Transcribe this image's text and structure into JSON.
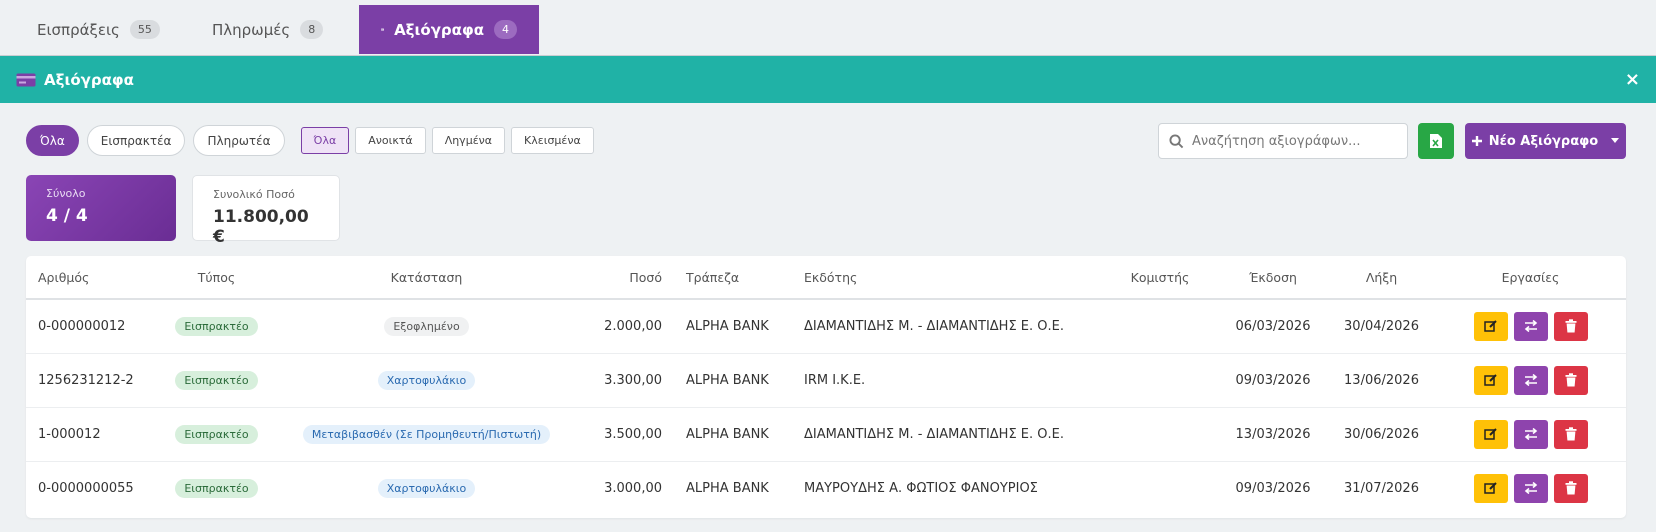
{
  "tabs": [
    {
      "label": "Εισπράξεις",
      "count": "55",
      "icon": "arrow-down-icon"
    },
    {
      "label": "Πληρωμές",
      "count": "8",
      "icon": "arrow-up-icon"
    },
    {
      "label": "Αξιόγραφα",
      "count": "4",
      "icon": "cheque-icon"
    }
  ],
  "panel": {
    "title": "Αξιόγραφα",
    "close": "×"
  },
  "type_filters": [
    "Όλα",
    "Εισπρακτέα",
    "Πληρωτέα"
  ],
  "status_filters": [
    "Όλα",
    "Ανοικτά",
    "Ληγμένα",
    "Κλεισμένα"
  ],
  "search": {
    "placeholder": "Αναζήτηση αξιογράφων..."
  },
  "new_button": {
    "label": "Νέο Αξιόγραφο"
  },
  "cards": {
    "total": {
      "label": "Σύνολο",
      "value": "4 / 4"
    },
    "amount": {
      "label": "Συνολικό Ποσό",
      "value": "11.800,00 €"
    }
  },
  "columns": [
    "Αριθμός",
    "Τύπος",
    "Κατάσταση",
    "Ποσό",
    "Τράπεζα",
    "Εκδότης",
    "Κομιστής",
    "Έκδοση",
    "Λήξη",
    "Εργασίες"
  ],
  "rows": [
    {
      "number": "0-000000012",
      "type": "Εισπρακτέο",
      "status": "Εξοφλημένο",
      "status_color": "grey",
      "amount": "2.000,00",
      "bank": "ALPHA BANK",
      "issuer": "ΔΙΑΜΑΝΤΙΔΗΣ Μ. - ΔΙΑΜΑΝΤΙΔΗΣ Ε. Ο.Ε.",
      "bearer": "",
      "issued": "06/03/2026",
      "due": "30/04/2026"
    },
    {
      "number": "1256231212-2",
      "type": "Εισπρακτέο",
      "status": "Χαρτοφυλάκιο",
      "status_color": "blue",
      "amount": "3.300,00",
      "bank": "ALPHA BANK",
      "issuer": "IRM I.K.E.",
      "bearer": "",
      "issued": "09/03/2026",
      "due": "13/06/2026"
    },
    {
      "number": "1-000012",
      "type": "Εισπρακτέο",
      "status": "Μεταβιβασθέν (Σε Προμηθευτή/Πιστωτή)",
      "status_color": "blue",
      "amount": "3.500,00",
      "bank": "ALPHA BANK",
      "issuer": "ΔΙΑΜΑΝΤΙΔΗΣ Μ. - ΔΙΑΜΑΝΤΙΔΗΣ Ε. Ο.Ε.",
      "bearer": "",
      "issued": "13/03/2026",
      "due": "30/06/2026"
    },
    {
      "number": "0-0000000055",
      "type": "Εισπρακτέο",
      "status": "Χαρτοφυλάκιο",
      "status_color": "blue",
      "amount": "3.000,00",
      "bank": "ALPHA BANK",
      "issuer": "ΜΑΥΡΟΥΔΗΣ Α. ΦΩΤΙΟΣ ΦΑΝΟΥΡΙΟΣ",
      "bearer": "",
      "issued": "09/03/2026",
      "due": "31/07/2026"
    }
  ],
  "colors": {
    "accent": "#7b3fa6",
    "header": "#20b2a6",
    "edit": "#ffc107",
    "swap": "#8e44ad",
    "delete": "#dc3545",
    "excel": "#28a745"
  }
}
